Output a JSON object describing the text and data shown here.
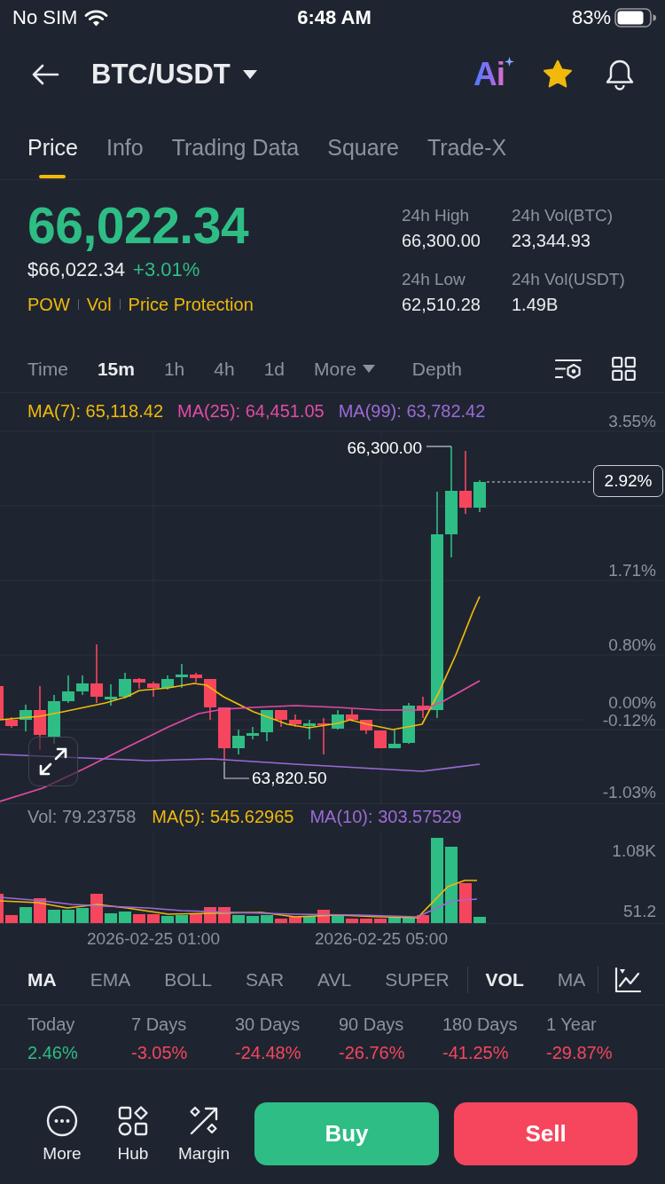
{
  "status_bar": {
    "carrier": "No SIM",
    "time": "6:48 AM",
    "battery": "83%"
  },
  "header": {
    "pair": "BTC/USDT",
    "ai_label": "Ai",
    "favorite": true
  },
  "tabs": [
    {
      "label": "Price",
      "selected": true
    },
    {
      "label": "Info",
      "selected": false
    },
    {
      "label": "Trading Data",
      "selected": false
    },
    {
      "label": "Square",
      "selected": false
    },
    {
      "label": "Trade-X",
      "selected": false
    }
  ],
  "price": {
    "last": "66,022.34",
    "fiat": "$66,022.34",
    "change": "+3.01%",
    "tags": [
      "POW",
      "Vol",
      "Price Protection"
    ]
  },
  "stats": [
    {
      "label": "24h High",
      "value": "66,300.00"
    },
    {
      "label": "24h Vol(BTC)",
      "value": "23,344.93"
    },
    {
      "label": "24h Low",
      "value": "62,510.28"
    },
    {
      "label": "24h Vol(USDT)",
      "value": "1.49B"
    }
  ],
  "intervals": [
    {
      "label": "Time",
      "selected": false
    },
    {
      "label": "15m",
      "selected": true
    },
    {
      "label": "1h",
      "selected": false
    },
    {
      "label": "4h",
      "selected": false
    },
    {
      "label": "1d",
      "selected": false
    }
  ],
  "more_menu": {
    "label": "More"
  },
  "depth": {
    "label": "Depth"
  },
  "chart": {
    "ma_legend": [
      {
        "label": "MA(7): 65,118.42",
        "color": "#f0b90b"
      },
      {
        "label": "MA(25): 64,451.05",
        "color": "#e24ba6"
      },
      {
        "label": "MA(99): 63,782.42",
        "color": "#9c6ad6"
      }
    ],
    "axis_labels": [
      "3.55%",
      "1.71%",
      "0.80%",
      "0.00%",
      "-0.12%",
      "-1.03%"
    ],
    "high_label": "66,300.00",
    "low_label": "63,820.50",
    "last_change": "2.92%"
  },
  "volume": {
    "label": "Vol: 79.23758",
    "ma_legend": [
      {
        "label": "MA(5): 545.62965",
        "color": "#f0b90b"
      },
      {
        "label": "MA(10): 303.57529",
        "color": "#9c6ad6"
      }
    ],
    "axis_labels": [
      "1.08K",
      "51.2"
    ],
    "time_labels": [
      "2026-02-25 01:00",
      "2026-02-25 05:00"
    ]
  },
  "indicators": {
    "main": [
      {
        "label": "MA",
        "selected": true
      },
      {
        "label": "EMA",
        "selected": false
      },
      {
        "label": "BOLL",
        "selected": false
      },
      {
        "label": "SAR",
        "selected": false
      },
      {
        "label": "AVL",
        "selected": false
      },
      {
        "label": "SUPER",
        "selected": false
      }
    ],
    "sub": [
      {
        "label": "VOL",
        "selected": true
      },
      {
        "label": "MA",
        "selected": false
      }
    ]
  },
  "performance": [
    {
      "label": "Today",
      "value": "2.46%",
      "positive": true
    },
    {
      "label": "7 Days",
      "value": "-3.05%",
      "positive": false
    },
    {
      "label": "30 Days",
      "value": "-24.48%",
      "positive": false
    },
    {
      "label": "90 Days",
      "value": "-26.76%",
      "positive": false
    },
    {
      "label": "180 Days",
      "value": "-41.25%",
      "positive": false
    },
    {
      "label": "1 Year",
      "value": "-29.87%",
      "positive": false
    }
  ],
  "actions": [
    {
      "label": "More",
      "kind": "more"
    },
    {
      "label": "Hub",
      "kind": "hub"
    },
    {
      "label": "Margin",
      "kind": "margin"
    }
  ],
  "trade_buttons": [
    {
      "label": "Buy",
      "kind": "buy"
    },
    {
      "label": "Sell",
      "kind": "sell"
    }
  ]
}
